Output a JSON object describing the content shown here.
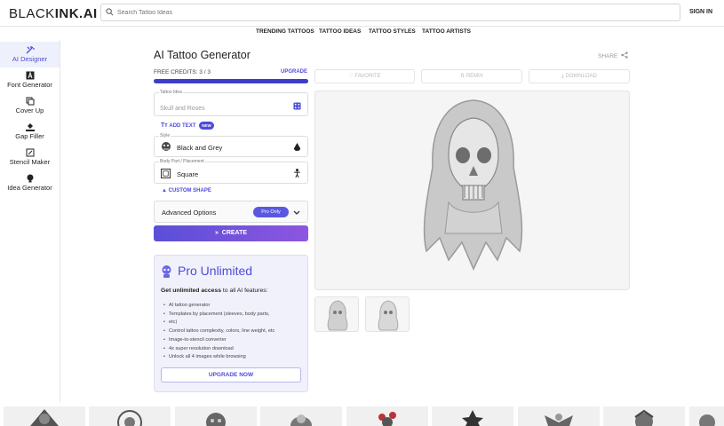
{
  "header": {
    "logo_light": "BLACK",
    "logo_bold": "INK.AI",
    "search_placeholder": "Search Tattoo Ideas",
    "signin": "SIGN IN"
  },
  "nav": [
    "TRENDING TATTOOS",
    "TATTOO IDEAS",
    "TATTOO STYLES",
    "TATTOO ARTISTS"
  ],
  "sidebar": {
    "items": [
      {
        "label": "AI Designer",
        "icon": "wand-icon",
        "active": true
      },
      {
        "label": "Font Generator",
        "icon": "font-icon"
      },
      {
        "label": "Cover Up",
        "icon": "layers-icon"
      },
      {
        "label": "Gap Filler",
        "icon": "paint-bucket-icon"
      },
      {
        "label": "Stencil Maker",
        "icon": "stencil-icon"
      },
      {
        "label": "Idea Generator",
        "icon": "lightbulb-icon"
      }
    ]
  },
  "main": {
    "title": "AI Tattoo Generator",
    "share": "SHARE",
    "credits": "FREE CREDITS: 3 / 3",
    "credits_fraction": 1,
    "upgrade_link": "UPGRADE",
    "tattoo_idea": {
      "label": "Tattoo Idea",
      "placeholder": "Skull and Roses"
    },
    "add_text": "ADD TEXT",
    "new_badge": "NEW",
    "style": {
      "label": "Style",
      "value": "Black and Grey"
    },
    "placement": {
      "label": "Body Part / Placement",
      "value": "Square"
    },
    "custom_shape": "CUSTOM SHAPE",
    "advanced": {
      "label": "Advanced Options",
      "badge": "Pro Only"
    },
    "create": "CREATE",
    "actions": {
      "favorite": "FAVORITE",
      "remix": "REMIX",
      "download": "DOWNLOAD"
    }
  },
  "pro_card": {
    "title": "Pro Unlimited",
    "subtitle_bold": "Get unlimited access",
    "subtitle_rest": " to all AI features:",
    "features": [
      "AI tattoo generator",
      "Templates by placement (sleeves, body parts,",
      "etc)",
      "Control tattoo complexity, colors, line weight, etc",
      "Image-to-stencil converter",
      "4x super resolution download",
      "Unlock all 4 images while browsing"
    ],
    "button": "UPGRADE NOW"
  },
  "colors": {
    "accent": "#4e4bd9",
    "create_gradient": [
      "#5a4fd8",
      "#8e55e0"
    ],
    "pro_card_bg": "#f1f1fb"
  }
}
